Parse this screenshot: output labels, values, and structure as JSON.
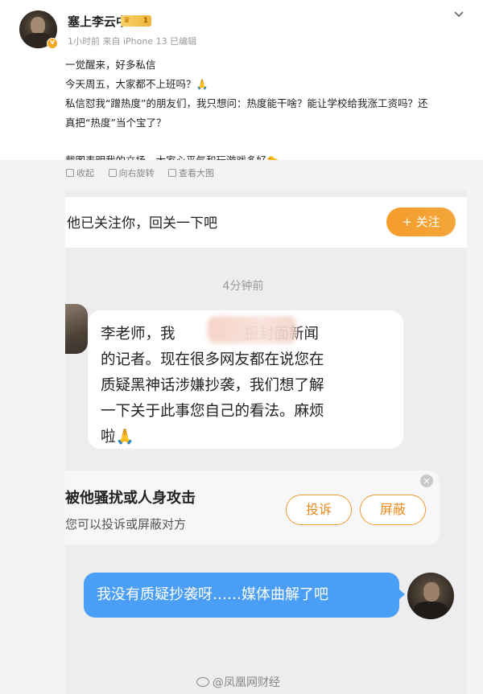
{
  "post": {
    "username": "塞上李云中",
    "level": "1",
    "meta": "1小时前  来自 iPhone 13 已编辑",
    "lines": [
      "一觉醒来，好多私信",
      "今天周五，大家都不上班吗？",
      "私信怼我“蹭热度”的朋友们，我只想问：热度能干啥？能让学校给我涨工资吗？还",
      "真把“热度”当个宝了？",
      "截图表明我的立场，大家心平气和玩游戏多好"
    ],
    "emoji_1": "🙏",
    "emoji_2": "🐤"
  },
  "image_tools": {
    "collect": "收起",
    "rotate": "向右旋转",
    "view_large": "查看大图"
  },
  "chat": {
    "follow_prompt": "他已关注你，回关一下吧",
    "follow_button": "+ 关注",
    "time": "4分钟前",
    "incoming": {
      "line1_a": "李老师，我",
      "line1_b": "报封面新闻",
      "line2": "的记者。现在很多网友都在说您在",
      "line3": "质疑黑神话涉嫌抄袭，我们想了解",
      "line4": "一下关于此事您自己的看法。麻烦",
      "line5": "啦",
      "emoji": "🙏"
    },
    "harass": {
      "title": "被他骚扰或人身攻击",
      "subtitle": "您可以投诉或屏蔽对方",
      "report": "投诉",
      "block": "屏蔽"
    },
    "outgoing": "我没有质疑抄袭呀……媒体曲解了吧"
  },
  "watermark": "@凤凰网财经"
}
